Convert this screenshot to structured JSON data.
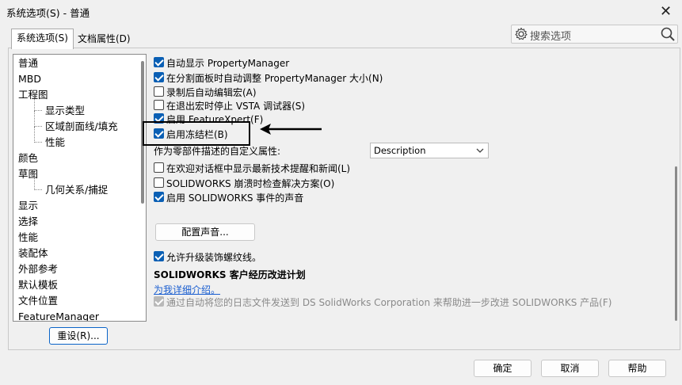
{
  "window": {
    "title": "系统选项(S) - 普通",
    "close_glyph": "✕"
  },
  "tabs": [
    {
      "label": "系统选项(S)"
    },
    {
      "label": "文档属性(D)"
    }
  ],
  "search": {
    "placeholder": "搜索选项",
    "left_icon": "gear-icon",
    "right_icon": "search-icon"
  },
  "tree": {
    "items": [
      {
        "label": "普通",
        "child": false
      },
      {
        "label": "MBD",
        "child": false
      },
      {
        "label": "工程图",
        "child": false
      },
      {
        "label": "显示类型",
        "child": true
      },
      {
        "label": "区域剖面线/填充",
        "child": true
      },
      {
        "label": "性能",
        "child": true
      },
      {
        "label": "颜色",
        "child": false
      },
      {
        "label": "草图",
        "child": false
      },
      {
        "label": "几何关系/捕捉",
        "child": true
      },
      {
        "label": "显示",
        "child": false
      },
      {
        "label": "选择",
        "child": false
      },
      {
        "label": "性能",
        "child": false
      },
      {
        "label": "装配体",
        "child": false
      },
      {
        "label": "外部参考",
        "child": false
      },
      {
        "label": "默认模板",
        "child": false
      },
      {
        "label": "文件位置",
        "child": false
      },
      {
        "label": "FeatureManager",
        "child": false
      }
    ]
  },
  "reset_button": "重设(R)...",
  "options": {
    "auto_show_pm": {
      "label": "自动显示 PropertyManager",
      "checked": true
    },
    "auto_resize_pm": {
      "label": "在分割面板时自动调整 PropertyManager 大小(N)",
      "checked": true
    },
    "auto_edit_macro": {
      "label": "录制后自动编辑宏(A)",
      "checked": false
    },
    "stop_vsta": {
      "label": "在退出宏时停止 VSTA 调试器(S)",
      "checked": false
    },
    "featurexpert": {
      "label": "启用 FeatureXpert(F)",
      "checked": true
    },
    "freeze_bar": {
      "label": "启用冻结栏(B)",
      "checked": true
    },
    "show_news": {
      "label": "在欢迎对话框中显示最新技术提醒和新闻(L)",
      "checked": false
    },
    "crash_check": {
      "label": "SOLIDWORKS 崩溃时检查解决方案(O)",
      "checked": false
    },
    "event_sounds": {
      "label": "启用 SOLIDWORKS 事件的声音",
      "checked": true
    },
    "upgrade_thread": {
      "label": "允许升级装饰螺纹线。",
      "checked": true
    },
    "send_logs": {
      "label": "通过自动将您的日志文件发送到 DS SolidWorks Corporation 来帮助进一步改进 SOLIDWORKS 产品(F)",
      "checked": true,
      "disabled": true
    }
  },
  "custom_property": {
    "label": "作为零部件描述的自定义属性:",
    "value": "Description"
  },
  "sound_button": "配置声音...",
  "ceip": {
    "title": "SOLIDWORKS 客户经历改进计划",
    "link": "为我详细介绍。"
  },
  "footer": {
    "ok": "确定",
    "cancel": "取消",
    "help": "帮助"
  },
  "colors": {
    "accent": "#0a5fb4",
    "link": "#1a5ed0",
    "disabled": "#8a8a8a"
  }
}
